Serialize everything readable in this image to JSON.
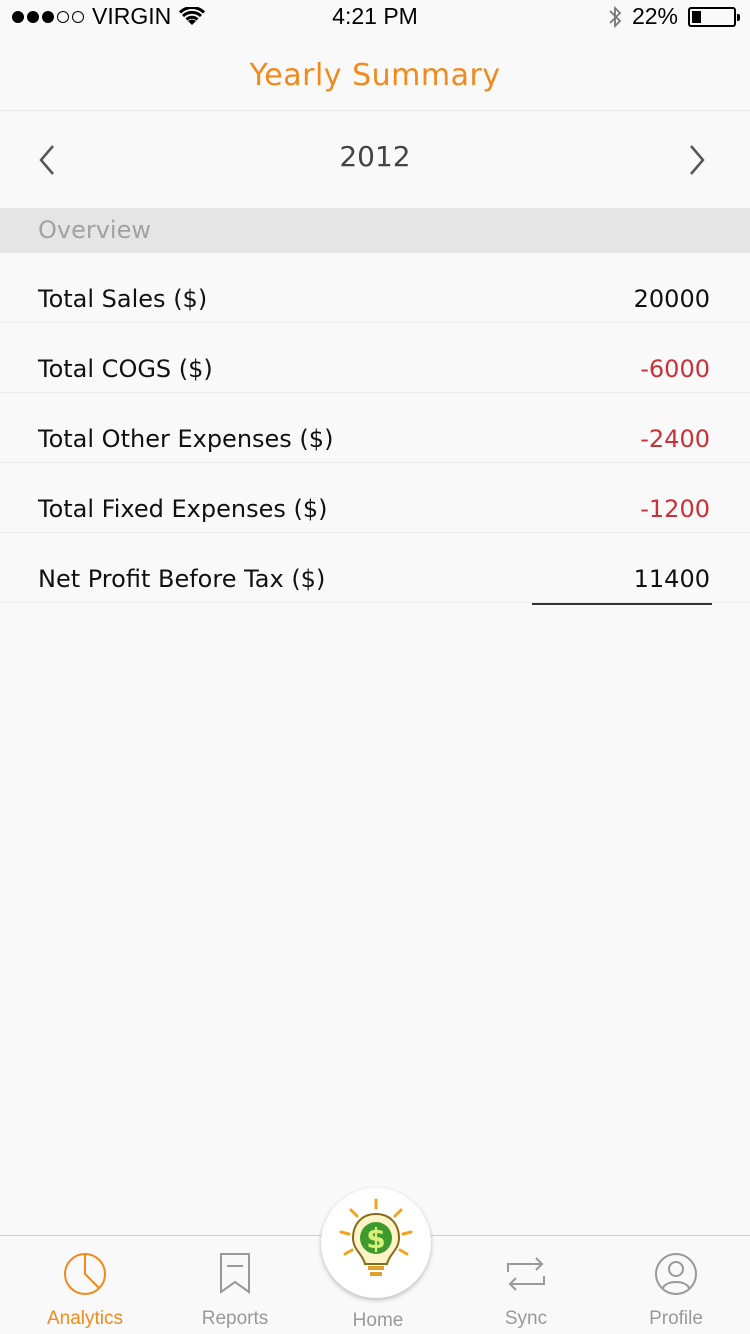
{
  "status_bar": {
    "carrier": "VIRGIN",
    "time": "4:21 PM",
    "battery_pct": "22%",
    "battery_level": 0.22,
    "signal_bars_filled": 3,
    "signal_bars_total": 5
  },
  "header": {
    "title": "Yearly Summary"
  },
  "year_nav": {
    "year": "2012"
  },
  "section": {
    "title": "Overview"
  },
  "rows": [
    {
      "label": "Total Sales ($)",
      "value": "20000",
      "negative": false
    },
    {
      "label": "Total COGS ($)",
      "value": "-6000",
      "negative": true
    },
    {
      "label": "Total Other Expenses ($)",
      "value": "-2400",
      "negative": true
    },
    {
      "label": "Total Fixed Expenses ($)",
      "value": "-1200",
      "negative": true
    },
    {
      "label": "Net Profit Before Tax ($)",
      "value": "11400",
      "negative": false
    }
  ],
  "tabs": [
    {
      "label": "Analytics",
      "icon": "pie-chart-icon",
      "active": true
    },
    {
      "label": "Reports",
      "icon": "bookmark-icon",
      "active": false
    },
    {
      "label": "Home",
      "icon": "lightbulb-dollar-icon",
      "active": false
    },
    {
      "label": "Sync",
      "icon": "sync-icon",
      "active": false
    },
    {
      "label": "Profile",
      "icon": "profile-icon",
      "active": false
    }
  ],
  "colors": {
    "accent": "#f08a1d",
    "negative": "#c8323a",
    "muted": "#999999"
  }
}
